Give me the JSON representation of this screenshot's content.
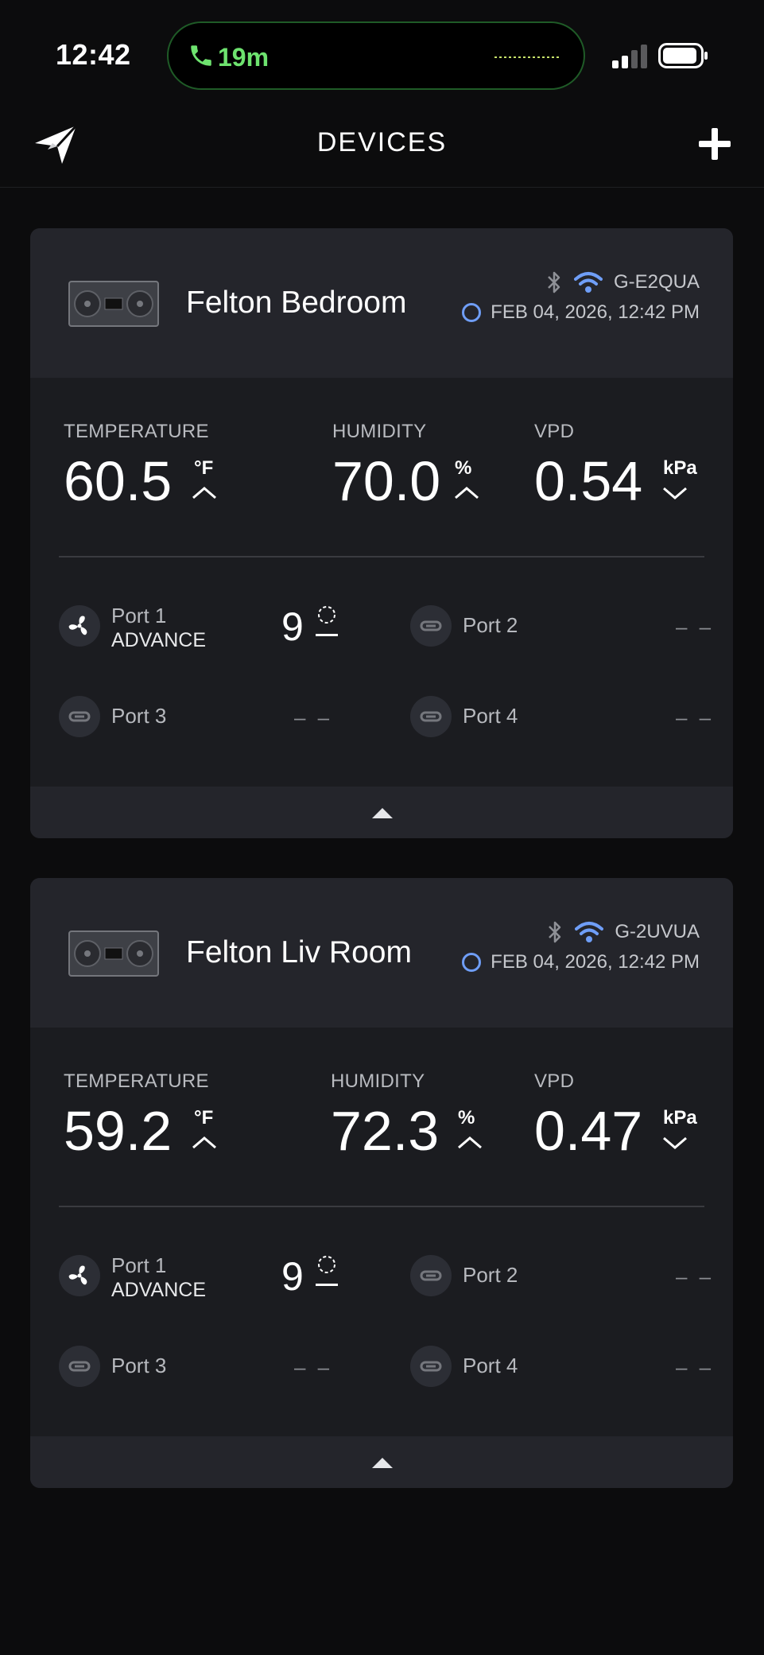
{
  "status_bar": {
    "time": "12:42",
    "call_duration": "19m"
  },
  "header": {
    "title": "DEVICES"
  },
  "icons": {
    "logo": "paper-plane-logo-icon",
    "add": "plus-icon",
    "bluetooth": "bluetooth-icon",
    "wifi": "wifi-icon",
    "status": "ring-icon",
    "fan": "fan-icon",
    "port_empty": "link-icon",
    "collapse": "triangle-up-icon"
  },
  "colors": {
    "background": "#0c0c0d",
    "card": "#1b1c20",
    "card_header": "#24252b",
    "wifi": "#6f9ef7",
    "call_green": "#6ee36f"
  },
  "devices": [
    {
      "name": "Felton Bedroom",
      "id": "G-E2QUA",
      "timestamp": "FEB 04, 2026, 12:42 PM",
      "metrics": [
        {
          "label": "TEMPERATURE",
          "value": "60.5",
          "unit": "°F",
          "trend": "up"
        },
        {
          "label": "HUMIDITY",
          "value": "70.0",
          "unit": "%",
          "trend": "up"
        },
        {
          "label": "VPD",
          "value": "0.54",
          "unit": "kPa",
          "trend": "down"
        }
      ],
      "ports": [
        {
          "name": "Port 1",
          "mode": "ADVANCE",
          "level": "9"
        },
        {
          "name": "Port 2",
          "value": "– –"
        },
        {
          "name": "Port 3",
          "value": "– –"
        },
        {
          "name": "Port 4",
          "value": "– –"
        }
      ]
    },
    {
      "name": "Felton Liv Room",
      "id": "G-2UVUA",
      "timestamp": "FEB 04, 2026, 12:42 PM",
      "metrics": [
        {
          "label": "TEMPERATURE",
          "value": "59.2",
          "unit": "°F",
          "trend": "up"
        },
        {
          "label": "HUMIDITY",
          "value": "72.3",
          "unit": "%",
          "trend": "up"
        },
        {
          "label": "VPD",
          "value": "0.47",
          "unit": "kPa",
          "trend": "down"
        }
      ],
      "ports": [
        {
          "name": "Port 1",
          "mode": "ADVANCE",
          "level": "9"
        },
        {
          "name": "Port 2",
          "value": "– –"
        },
        {
          "name": "Port 3",
          "value": "– –"
        },
        {
          "name": "Port 4",
          "value": "– –"
        }
      ]
    }
  ]
}
